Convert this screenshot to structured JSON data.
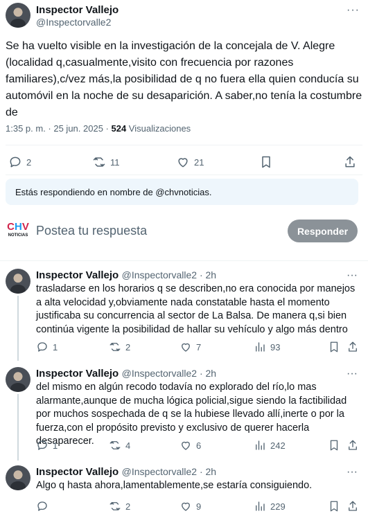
{
  "main_tweet": {
    "name": "Inspector Vallejo",
    "handle": "@Inspectorvalle2",
    "text": "Se ha vuelto visible en la investigación de la concejala de V. Alegre (localidad q,casualmente,visito con frecuencia por razones familiares),c/vez más,la posibilidad de q no fuera ella quien conducía su automóvil en la noche de su desaparición. A saber,no tenía la costumbre de",
    "time": "1:35 p. m. · 25 jun. 2025 · ",
    "views_count": "524",
    "views_label": " Visualizaciones",
    "replies": "2",
    "retweets": "11",
    "likes": "21"
  },
  "reply_banner": {
    "text": "Estás respondiendo en nombre de @chvnoticias."
  },
  "composer": {
    "logo_text": "NOTICIAS",
    "placeholder": "Postea tu respuesta",
    "button": "Responder"
  },
  "replies": [
    {
      "name": "Inspector Vallejo",
      "handle": "@Inspectorvalle2 · 2h",
      "text": "trasladarse en los horarios q se describen,no era conocida por manejos a alta velocidad y,obviamente nada constatable hasta el momento justificaba su concurrencia al sector de La Balsa. De manera q,si bien continúa vigente la posibilidad de hallar su vehículo y algo más dentro",
      "replies": "1",
      "retweets": "2",
      "likes": "7",
      "views": "93"
    },
    {
      "name": "Inspector Vallejo",
      "handle": "@Inspectorvalle2 · 2h",
      "text": "del mismo en algún recodo todavía no explorado del río,lo mas alarmante,aunque de mucha lógica policial,sigue siendo la factibilidad por muchos sospechada de q se la hubiese llevado allí,inerte o por la fuerza,con el propósito previsto y exclusivo de querer hacerla desaparecer.",
      "replies": "1",
      "retweets": "4",
      "likes": "6",
      "views": "242"
    },
    {
      "name": "Inspector Vallejo",
      "handle": "@Inspectorvalle2 · 2h",
      "text": "Algo q hasta ahora,lamentablemente,se estaría consiguiendo.",
      "replies": "",
      "retweets": "2",
      "likes": "9",
      "views": "229"
    }
  ]
}
